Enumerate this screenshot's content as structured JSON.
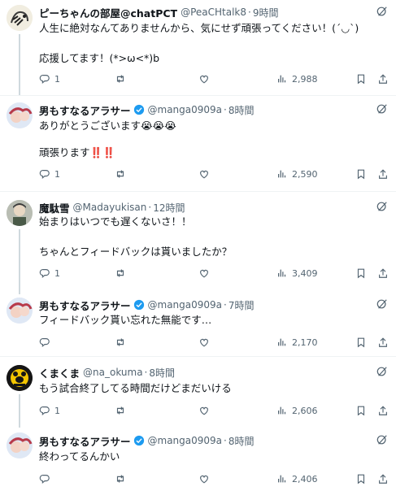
{
  "tweets": [
    {
      "name": "ピーちゃんの部屋@chatPCT",
      "handle": "@PeaCHtalk8",
      "time": "9時間",
      "verified": false,
      "line1": "人生に絶対なんてありませんから、気にせず頑張ってください！(´◡`)",
      "line2": "応援してます！(*>ω<*)b",
      "replies": "1",
      "views": "2,988"
    },
    {
      "name": "男もすなるアラサー",
      "handle": "@manga0909a",
      "time": "8時間",
      "verified": true,
      "line1": "ありがとうございます😭😭😭",
      "line2": "頑張ります‼️‼️",
      "replies": "1",
      "views": "2,590"
    },
    {
      "name": "魔駄雪",
      "handle": "@Madayukisan",
      "time": "12時間",
      "verified": false,
      "line1": "始まりはいつでも遅くないさ！！",
      "line2": "ちゃんとフィードバックは貰いましたか？",
      "replies": "1",
      "views": "3,409"
    },
    {
      "name": "男もすなるアラサー",
      "handle": "@manga0909a",
      "time": "7時間",
      "verified": true,
      "line1": "フィードバック貰い忘れた無能です…",
      "line2": "",
      "replies": "",
      "views": "2,170"
    },
    {
      "name": "くまくま",
      "handle": "@na_okuma",
      "time": "8時間",
      "verified": false,
      "line1": "もう試合終了してる時間だけどまだいける",
      "line2": "",
      "replies": "1",
      "views": "2,606"
    },
    {
      "name": "男もすなるアラサー",
      "handle": "@manga0909a",
      "time": "8時間",
      "verified": true,
      "line1": "終わってるんかい",
      "line2": "",
      "replies": "",
      "views": "2,406"
    }
  ],
  "separator": "·",
  "icons": {
    "reply": "reply-icon",
    "retweet": "retweet-icon",
    "like": "like-icon",
    "views": "views-icon",
    "bookmark": "bookmark-icon",
    "share": "share-icon",
    "more": "grok-icon",
    "verified": "verified-badge-icon"
  },
  "colors": {
    "text": "#0f1419",
    "secondary": "#536471",
    "verified": "#1d9bf0",
    "thread_line": "#cfd9de",
    "divider": "#eff3f4"
  }
}
